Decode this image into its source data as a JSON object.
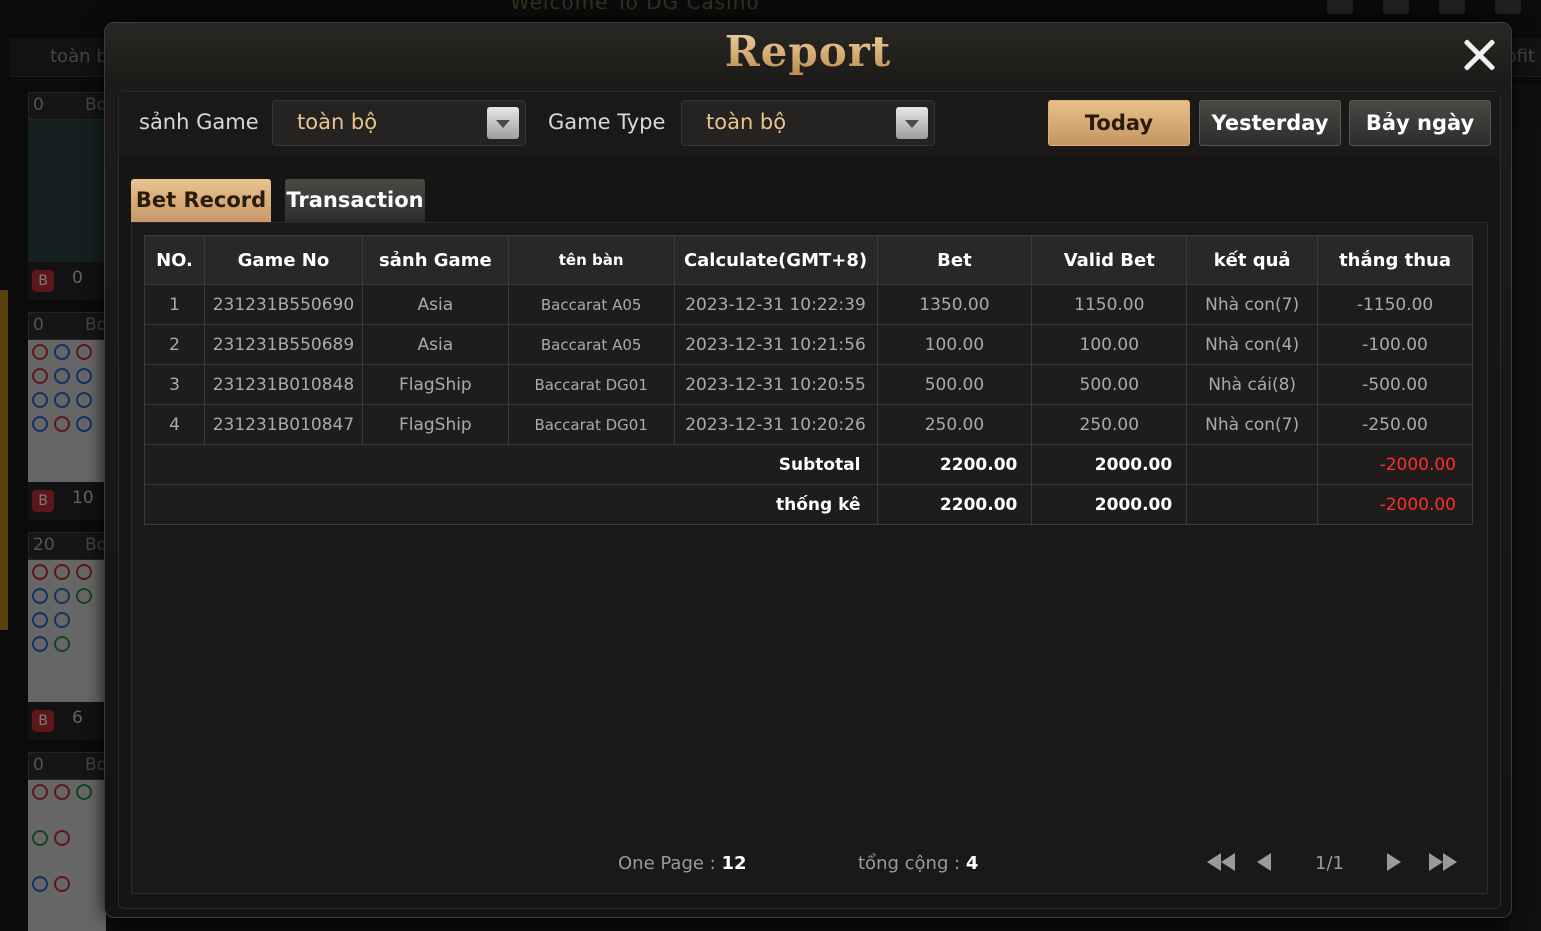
{
  "background": {
    "title": "Welcome To DG Casino",
    "tab_left": "toàn b",
    "tab_right": "ofit",
    "columns": [
      {
        "head_num": "0",
        "head_text": "Bo",
        "foot_num": "0"
      },
      {
        "head_num": "0",
        "head_text": "Bo",
        "foot_num": "10"
      },
      {
        "head_num": "20",
        "head_text": "Bo",
        "foot_num": "6"
      },
      {
        "head_num": "0",
        "head_text": "Bo",
        "foot_num": ""
      }
    ],
    "banker_badge": "B"
  },
  "modal": {
    "title": "Report",
    "close_icon": "close-icon"
  },
  "filters": {
    "hall_label": "sảnh Game",
    "hall_value": "toàn bộ",
    "game_type_label": "Game Type",
    "game_type_value": "toàn bộ",
    "date_buttons": {
      "today": "Today",
      "yesterday": "Yesterday",
      "seven_days": "Bảy ngày"
    },
    "active_date": "Today"
  },
  "tabs": {
    "bet_record": "Bet Record",
    "transaction": "Transaction",
    "active": "Bet Record"
  },
  "table": {
    "headers": {
      "no": "NO.",
      "game_no": "Game No",
      "hall": "sảnh Game",
      "table_name": "tên bàn",
      "calc": "Calculate(GMT+8)",
      "bet": "Bet",
      "valid_bet": "Valid Bet",
      "result": "kết quả",
      "win_loss": "thắng thua"
    },
    "rows": [
      {
        "no": "1",
        "game_no": "231231B550690",
        "hall": "Asia",
        "table_name": "Baccarat A05",
        "calc": "2023-12-31 10:22:39",
        "bet": "1350.00",
        "valid_bet": "1150.00",
        "result": "Nhà con(7)",
        "win_loss": "-1150.00"
      },
      {
        "no": "2",
        "game_no": "231231B550689",
        "hall": "Asia",
        "table_name": "Baccarat A05",
        "calc": "2023-12-31 10:21:56",
        "bet": "100.00",
        "valid_bet": "100.00",
        "result": "Nhà con(4)",
        "win_loss": "-100.00"
      },
      {
        "no": "3",
        "game_no": "231231B010848",
        "hall": "FlagShip",
        "table_name": "Baccarat DG01",
        "calc": "2023-12-31 10:20:55",
        "bet": "500.00",
        "valid_bet": "500.00",
        "result": "Nhà cái(8)",
        "win_loss": "-500.00"
      },
      {
        "no": "4",
        "game_no": "231231B010847",
        "hall": "FlagShip",
        "table_name": "Baccarat DG01",
        "calc": "2023-12-31 10:20:26",
        "bet": "250.00",
        "valid_bet": "250.00",
        "result": "Nhà con(7)",
        "win_loss": "-250.00"
      }
    ],
    "subtotal": {
      "label": "Subtotal",
      "bet": "2200.00",
      "valid_bet": "2000.00",
      "win_loss": "-2000.00"
    },
    "statistics": {
      "label": "thống kê",
      "bet": "2200.00",
      "valid_bet": "2000.00",
      "win_loss": "-2000.00"
    }
  },
  "footer": {
    "one_page_label": "One Page :",
    "one_page_value": "12",
    "total_label": "tổng cộng :",
    "total_value": "4",
    "page_info": "1/1"
  },
  "colors": {
    "accent_gold": "#e9c48c",
    "player_blue": "#2f8cff",
    "banker_red": "#ff2d2d"
  }
}
